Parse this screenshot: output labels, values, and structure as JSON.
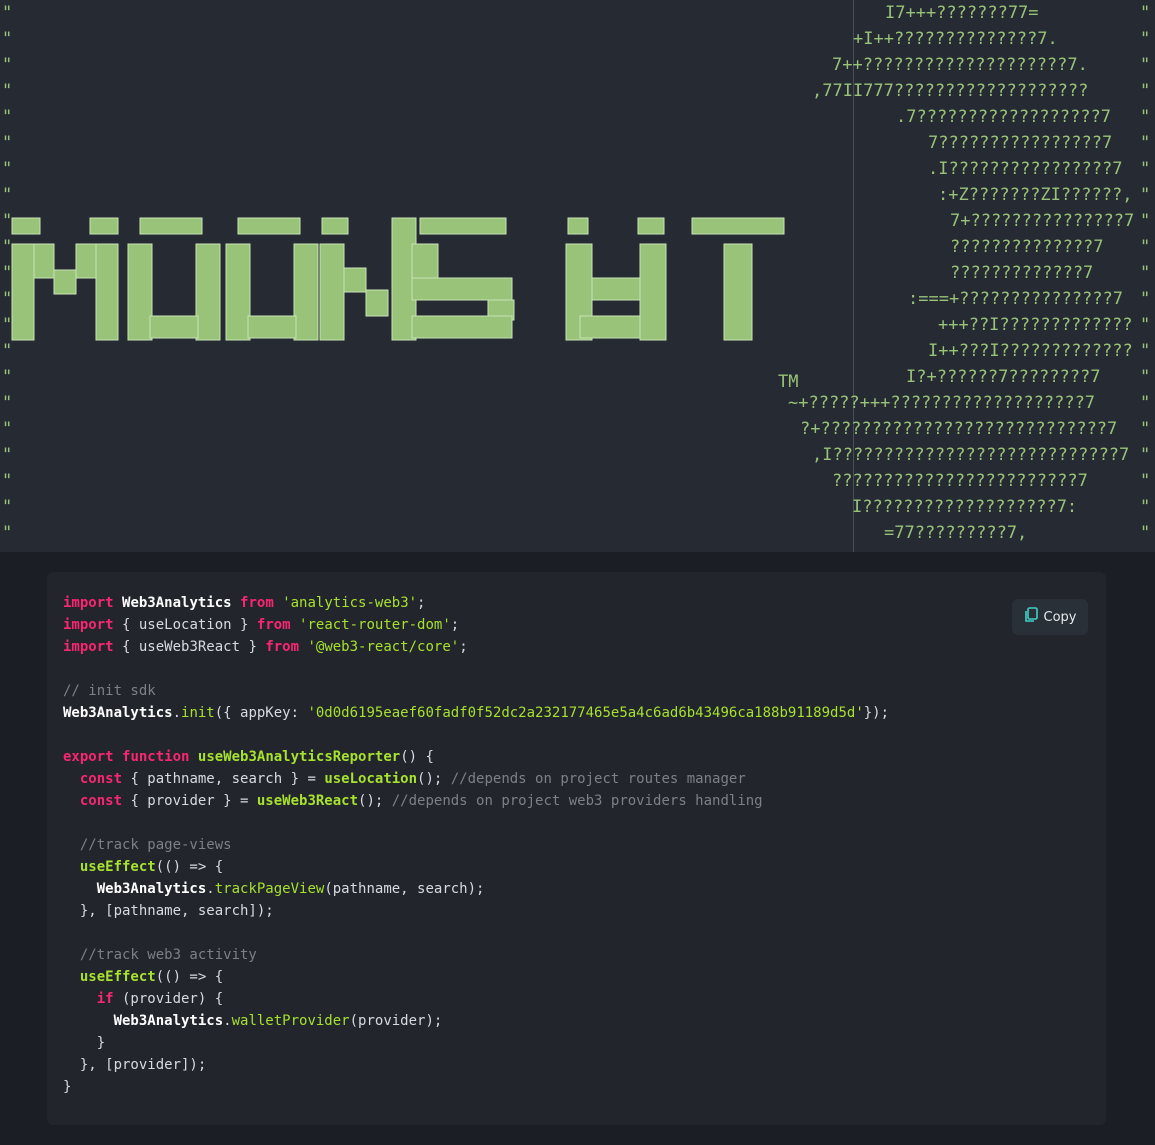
{
  "hero": {
    "quote_mark": "\"",
    "logo_text": "MOONSHOT",
    "trademark": "TM",
    "art_lines": [
      "I7+++???????77=",
      "+I++??????????????7.",
      "7++????????????????????7.",
      ",77II777???????????????????",
      ".7??????????????????7",
      "7????????????????7",
      ".I????????????????7",
      ":+Z???????ZI??????,",
      "7+???????????????7",
      "??????????????7",
      "?????????????7",
      ":===+???????????????7",
      "+++??I?????????????",
      "I++???I?????????????",
      "I?+??????7????????7",
      "~+?????+++???????????????????7",
      "?+????????????????????????????7",
      ",I????????????????????????????7",
      "????????????????????????7",
      "I???????????????????7:",
      "=77?????????7,"
    ]
  },
  "code": {
    "copy_label": "Copy",
    "icon": "copy-icon",
    "lines": {
      "l1": [
        "import",
        "Web3Analytics",
        "from",
        "'analytics-web3'",
        ";"
      ],
      "l2": [
        "import",
        "{ useLocation }",
        "from",
        "'react-router-dom'",
        ";"
      ],
      "l3": [
        "import",
        "{ useWeb3React }",
        "from",
        "'@web3-react/core'",
        ";"
      ],
      "l5": "// init sdk",
      "l6": [
        "Web3Analytics",
        ".",
        "init",
        "({ appKey: ",
        "'0d0d6195eaef60fadf0f52dc2a232177465e5a4c6ad6b43496ca188b91189d5d'",
        "});"
      ],
      "l8": [
        "export",
        "function",
        "useWeb3AnalyticsReporter",
        "() {"
      ],
      "l9": [
        "  ",
        "const",
        " { pathname, search } = ",
        "useLocation",
        "(); ",
        "//depends on project routes manager"
      ],
      "l10": [
        "  ",
        "const",
        " { provider } = ",
        "useWeb3React",
        "(); ",
        "//depends on project web3 providers handling"
      ],
      "l12": "  //track page-views",
      "l13": [
        "  ",
        "useEffect",
        "(() => {"
      ],
      "l14": [
        "    ",
        "Web3Analytics",
        ".",
        "trackPageView",
        "(pathname, search);"
      ],
      "l15": "  }, [pathname, search]);",
      "l17": "  //track web3 activity",
      "l18": [
        "  ",
        "useEffect",
        "(() => {"
      ],
      "l19": [
        "    ",
        "if",
        " (provider) {"
      ],
      "l20": [
        "      ",
        "Web3Analytics",
        ".",
        "walletProvider",
        "(provider);"
      ],
      "l21": "    }",
      "l22": "  }, [provider]);",
      "l23": "}"
    }
  }
}
